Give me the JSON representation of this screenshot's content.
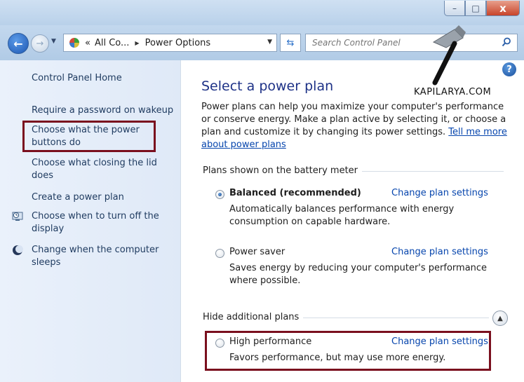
{
  "window": {
    "controls": {
      "minimize": "–",
      "maximize": "□",
      "close": "x"
    }
  },
  "address_bar": {
    "crumbs": [
      "«",
      "All Co...",
      "Power Options"
    ],
    "search_placeholder": "Search Control Panel"
  },
  "sidebar": {
    "items": [
      {
        "label": "Control Panel Home"
      },
      {
        "label": "Require a password on wakeup"
      },
      {
        "label": "Choose what the power buttons do",
        "highlighted": true
      },
      {
        "label": "Choose what closing the lid does"
      },
      {
        "label": "Create a power plan"
      },
      {
        "label": "Choose when to turn off the display",
        "icon": "clock-monitor-icon"
      },
      {
        "label": "Change when the computer sleeps",
        "icon": "moon-icon"
      }
    ]
  },
  "main": {
    "title": "Select a power plan",
    "intro_text": "Power plans can help you maximize your computer's performance or conserve energy. Make a plan active by selecting it, or choose a plan and customize it by changing its power settings.",
    "intro_link": "Tell me more about power plans",
    "groups": [
      {
        "label": "Plans shown on the battery meter",
        "plans": [
          {
            "name": "Balanced (recommended)",
            "selected": true,
            "link": "Change plan settings",
            "description": "Automatically balances performance with energy consumption on capable hardware."
          },
          {
            "name": "Power saver",
            "selected": false,
            "link": "Change plan settings",
            "description": "Saves energy by reducing your computer's performance where possible."
          }
        ]
      },
      {
        "label": "Hide additional plans",
        "plans": [
          {
            "name": "High performance",
            "selected": false,
            "link": "Change plan settings",
            "description": "Favors performance, but may use more energy.",
            "highlighted": true
          }
        ]
      }
    ]
  },
  "watermark": {
    "text": "KAPILARYA.COM"
  },
  "colors": {
    "highlight_box": "#7a0f1e",
    "link": "#0645ad",
    "title": "#1e3287"
  }
}
